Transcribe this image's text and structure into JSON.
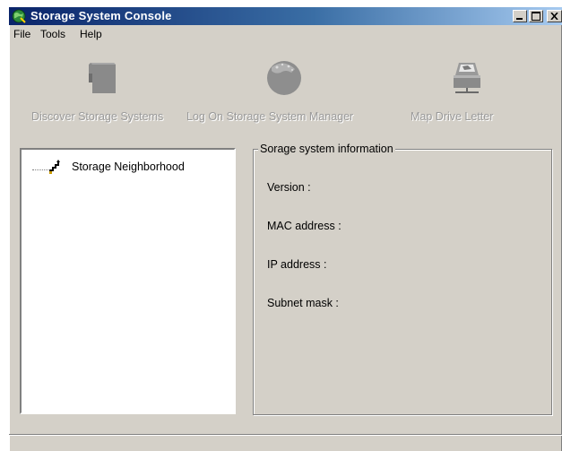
{
  "window": {
    "title": "Storage System Console"
  },
  "menu": {
    "items": [
      "File",
      "Tools",
      "Help"
    ]
  },
  "toolbar": {
    "discover_label": "Discover Storage Systems",
    "logon_label": "Log On Storage System Manager",
    "map_label": "Map Drive Letter"
  },
  "tree": {
    "root_label": "Storage Neighborhood"
  },
  "info": {
    "legend": "Sorage system information",
    "version_label": "Version :",
    "mac_label": "MAC address :",
    "ip_label": "IP address :",
    "subnet_label": "Subnet mask :"
  },
  "colors": {
    "face": "#d4d0c8",
    "title_start": "#0a246a",
    "title_end": "#a6caf0",
    "disabled_text": "#9a9a9a"
  }
}
